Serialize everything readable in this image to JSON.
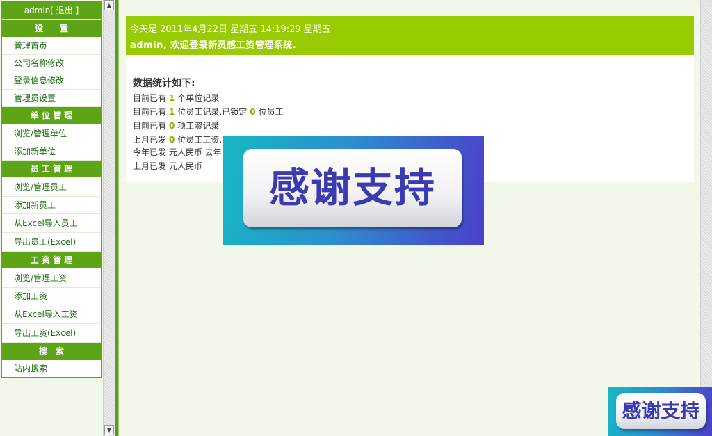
{
  "sidebar": {
    "user": "admin[ 退出 ]",
    "sections": [
      {
        "title": "设　　置",
        "items": [
          "管理首页",
          "公司名称修改",
          "登录信息修改",
          "管理员设置"
        ]
      },
      {
        "title": "单 位 管 理",
        "items": [
          "浏览/管理单位",
          "添加新单位"
        ]
      },
      {
        "title": "员 工 管 理",
        "items": [
          "浏览/管理员工",
          "添加新员工",
          "从Excel导入员工",
          "导出员工(Excel)"
        ]
      },
      {
        "title": "工 资 管 理",
        "items": [
          "浏览/管理工资",
          "添加工资",
          "从Excel导入工资",
          "导出工资(Excel)"
        ]
      },
      {
        "title": "搜　索",
        "items": [
          "站内搜索"
        ]
      }
    ]
  },
  "welcome": {
    "date_line": "今天是 2011年4月22日 星期五 14:19:29 星期五",
    "greeting": "admin, 欢迎登录新灵感工资管理系统."
  },
  "stats": {
    "title": "数据统计如下:",
    "row1": {
      "prefix": "目前已有",
      "count": "1",
      "suffix": "个单位记录"
    },
    "row2": {
      "prefix": "目前已有",
      "count": "1",
      "mid": "位员工记录,已锁定",
      "count2": "0",
      "suffix": "位员工"
    },
    "row3": {
      "prefix": "目前已有",
      "count": "0",
      "suffix": "项工资记录"
    },
    "row4": {
      "prefix": "上月已发",
      "count": "0",
      "suffix": "位员工工资."
    },
    "row5": {
      "prefix": "今年已发",
      "text": "元人民币 去年"
    },
    "row6": {
      "prefix": "上月已发",
      "text": "元人民币"
    }
  },
  "banners": {
    "big": "感谢支持",
    "small": "感谢支持"
  },
  "colors": {
    "menu_header": "#5da416",
    "welcome_bg": "#99cc00",
    "page_bg": "#f2f8e9",
    "link": "#1f6e12",
    "count": "#86b300"
  }
}
